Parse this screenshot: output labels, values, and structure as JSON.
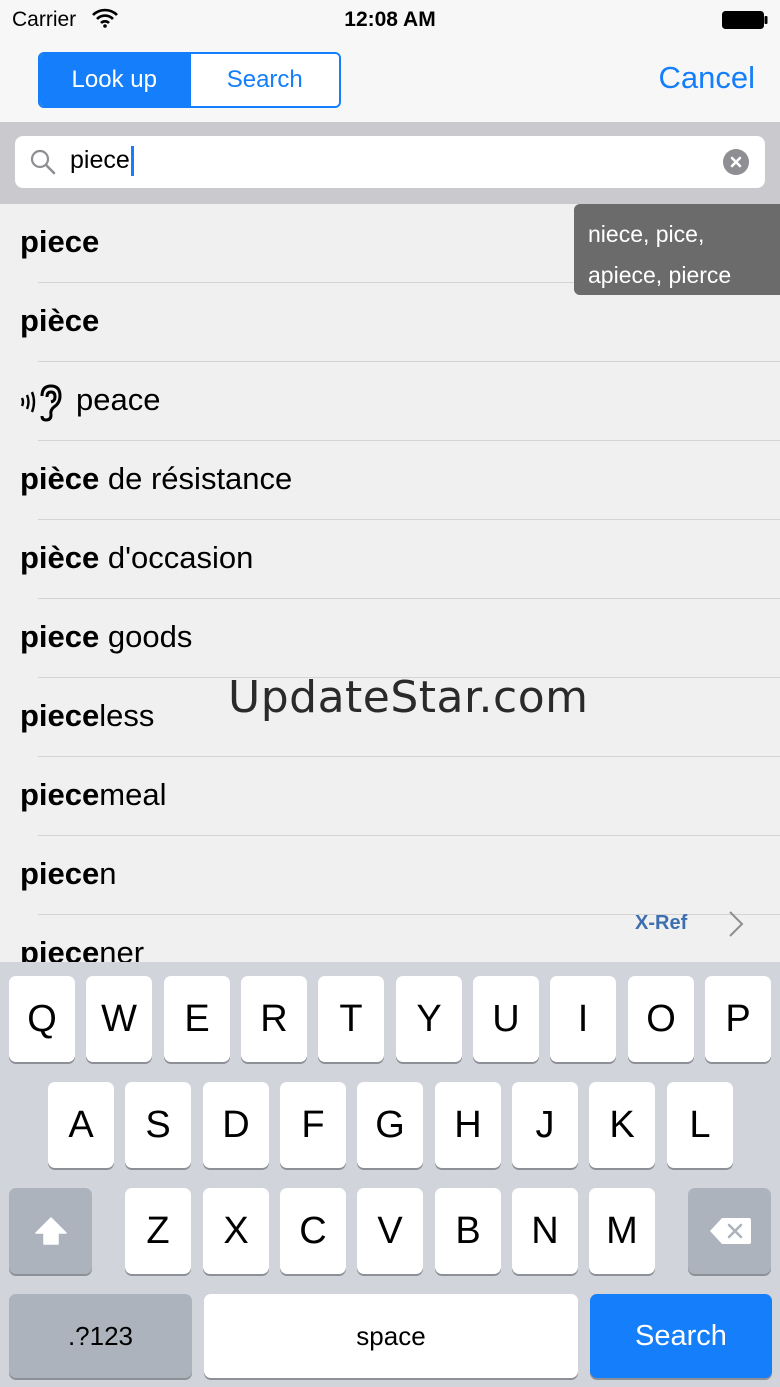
{
  "status": {
    "carrier": "Carrier",
    "time": "12:08 AM"
  },
  "nav": {
    "segments": [
      "Look up",
      "Search"
    ],
    "active_segment": "Look up",
    "cancel_label": "Cancel"
  },
  "search": {
    "query": "piece"
  },
  "suggestion": {
    "line1": "niece, pice,",
    "line2": "apiece, pierce"
  },
  "results": [
    {
      "bold": "piece",
      "rest": ""
    },
    {
      "bold": "pièce",
      "rest": ""
    },
    {
      "bold": "",
      "rest": "peace",
      "icon": "ear-sound-icon"
    },
    {
      "bold": "pièce",
      "rest": " de résistance"
    },
    {
      "bold": "pièce",
      "rest": " d'occasion"
    },
    {
      "bold": "piece",
      "rest": " goods"
    },
    {
      "bold": "piece",
      "rest": "less"
    },
    {
      "bold": "piece",
      "rest": "meal"
    },
    {
      "bold": "piece",
      "rest": "n"
    },
    {
      "bold": "piece",
      "rest": "ner"
    }
  ],
  "xref": {
    "label": "X-Ref"
  },
  "watermark": "UpdateStar.com",
  "keyboard": {
    "row1": [
      "Q",
      "W",
      "E",
      "R",
      "T",
      "Y",
      "U",
      "I",
      "O",
      "P"
    ],
    "row2": [
      "A",
      "S",
      "D",
      "F",
      "G",
      "H",
      "J",
      "K",
      "L"
    ],
    "row3": [
      "Z",
      "X",
      "C",
      "V",
      "B",
      "N",
      "M"
    ],
    "numbers_label": ".?123",
    "space_label": "space",
    "search_label": "Search"
  },
  "colors": {
    "accent": "#147efb"
  }
}
